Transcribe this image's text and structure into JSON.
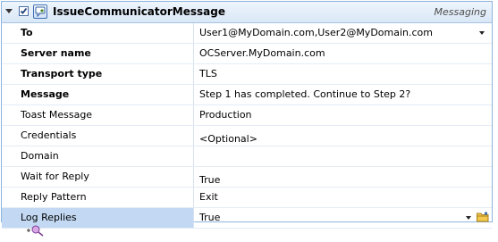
{
  "activity": {
    "title": "IssueCommunicatorMessage",
    "category": "Messaging",
    "enabled": true
  },
  "properties": [
    {
      "name": "To",
      "value": "User1@MyDomain.com,User2@MyDomain.com",
      "required": true,
      "control": "dropdown"
    },
    {
      "name": "Server name",
      "value": "OCServer.MyDomain.com",
      "required": true
    },
    {
      "name": "Transport type",
      "value": "TLS",
      "required": true
    },
    {
      "name": "Message",
      "value": "Step 1 has completed. Continue to Step 2?",
      "required": true
    },
    {
      "name": "Toast Message",
      "value": "Production",
      "required": false
    },
    {
      "name": "Credentials",
      "value": "<Optional>",
      "required": false
    },
    {
      "name": "Domain",
      "value": "",
      "required": false
    },
    {
      "name": "Wait for Reply",
      "value": "True",
      "required": false
    },
    {
      "name": "Reply Pattern",
      "value": "Exit",
      "required": false
    },
    {
      "name": "Log Replies",
      "value": "True",
      "required": false,
      "control": "dropdown-with-browse",
      "selected": true
    }
  ],
  "icons": {
    "collapse": "collapse-arrow-icon",
    "activity": "communicator-message-icon",
    "add": "add-activity-icon",
    "browse": "browse-folder-icon"
  },
  "colors": {
    "header_bg": "#d9e7f6",
    "border": "#8eb4dc",
    "selected_row": "#c3d9f3"
  }
}
